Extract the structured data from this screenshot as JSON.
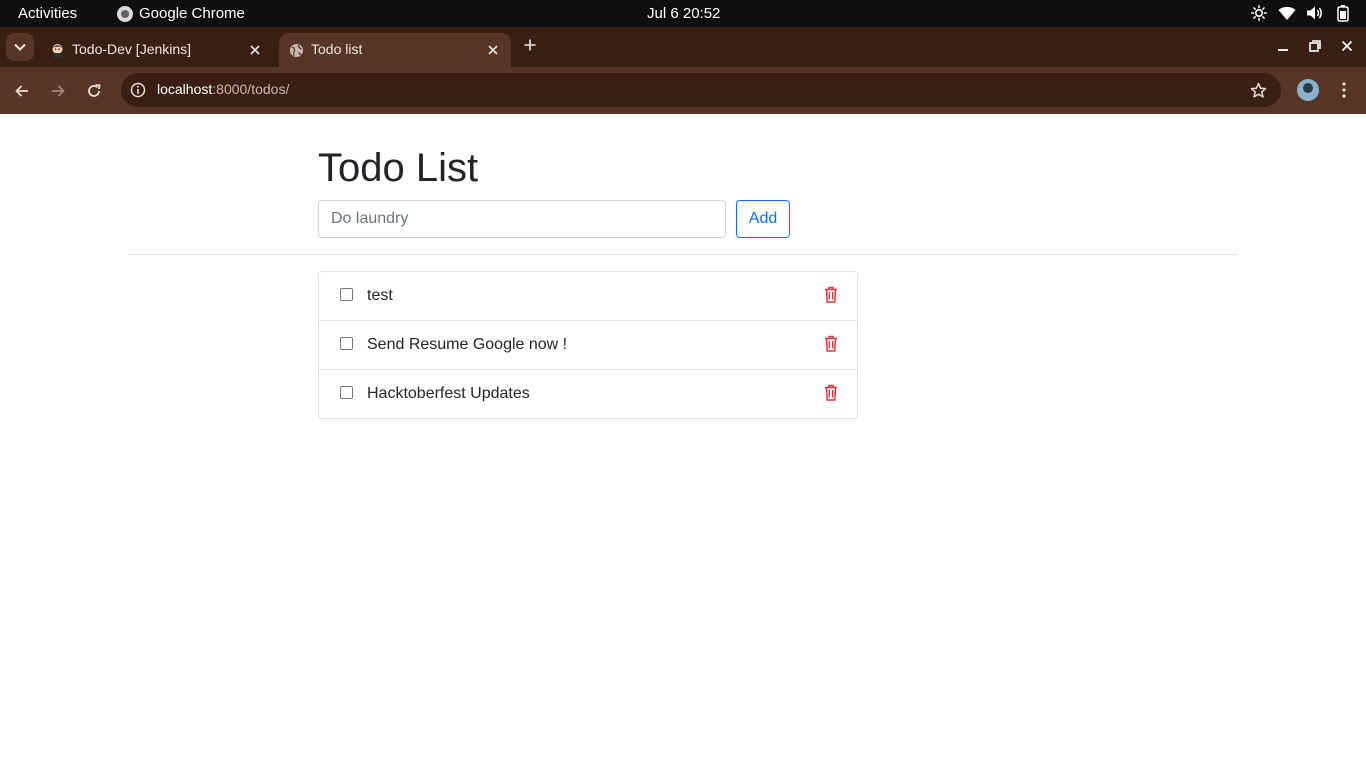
{
  "system_bar": {
    "activities": "Activities",
    "app_name": "Google Chrome",
    "clock": "Jul 6  20:52"
  },
  "tabs": [
    {
      "title": "Todo-Dev [Jenkins]",
      "active": false
    },
    {
      "title": "Todo list",
      "active": true
    }
  ],
  "address_bar": {
    "host": "localhost",
    "path": ":8000/todos/"
  },
  "page": {
    "heading": "Todo List",
    "input_placeholder": "Do laundry",
    "add_label": "Add",
    "todos": [
      {
        "text": "test",
        "done": false
      },
      {
        "text": "Send Resume Google now !",
        "done": false
      },
      {
        "text": "Hacktoberfest Updates",
        "done": false
      }
    ]
  },
  "colors": {
    "accent": "#0d6efd",
    "delete": "#dc3545",
    "browser_frame": "#3a1f14",
    "browser_toolbar": "#573628"
  },
  "icons": [
    "chrome-icon",
    "brightness-icon",
    "wifi-icon",
    "volume-icon",
    "battery-icon",
    "jenkins-favicon",
    "globe-favicon",
    "close-icon",
    "plus-icon",
    "minimize-icon",
    "restore-icon",
    "back-icon",
    "forward-icon",
    "reload-icon",
    "info-icon",
    "star-icon",
    "trash-icon"
  ]
}
